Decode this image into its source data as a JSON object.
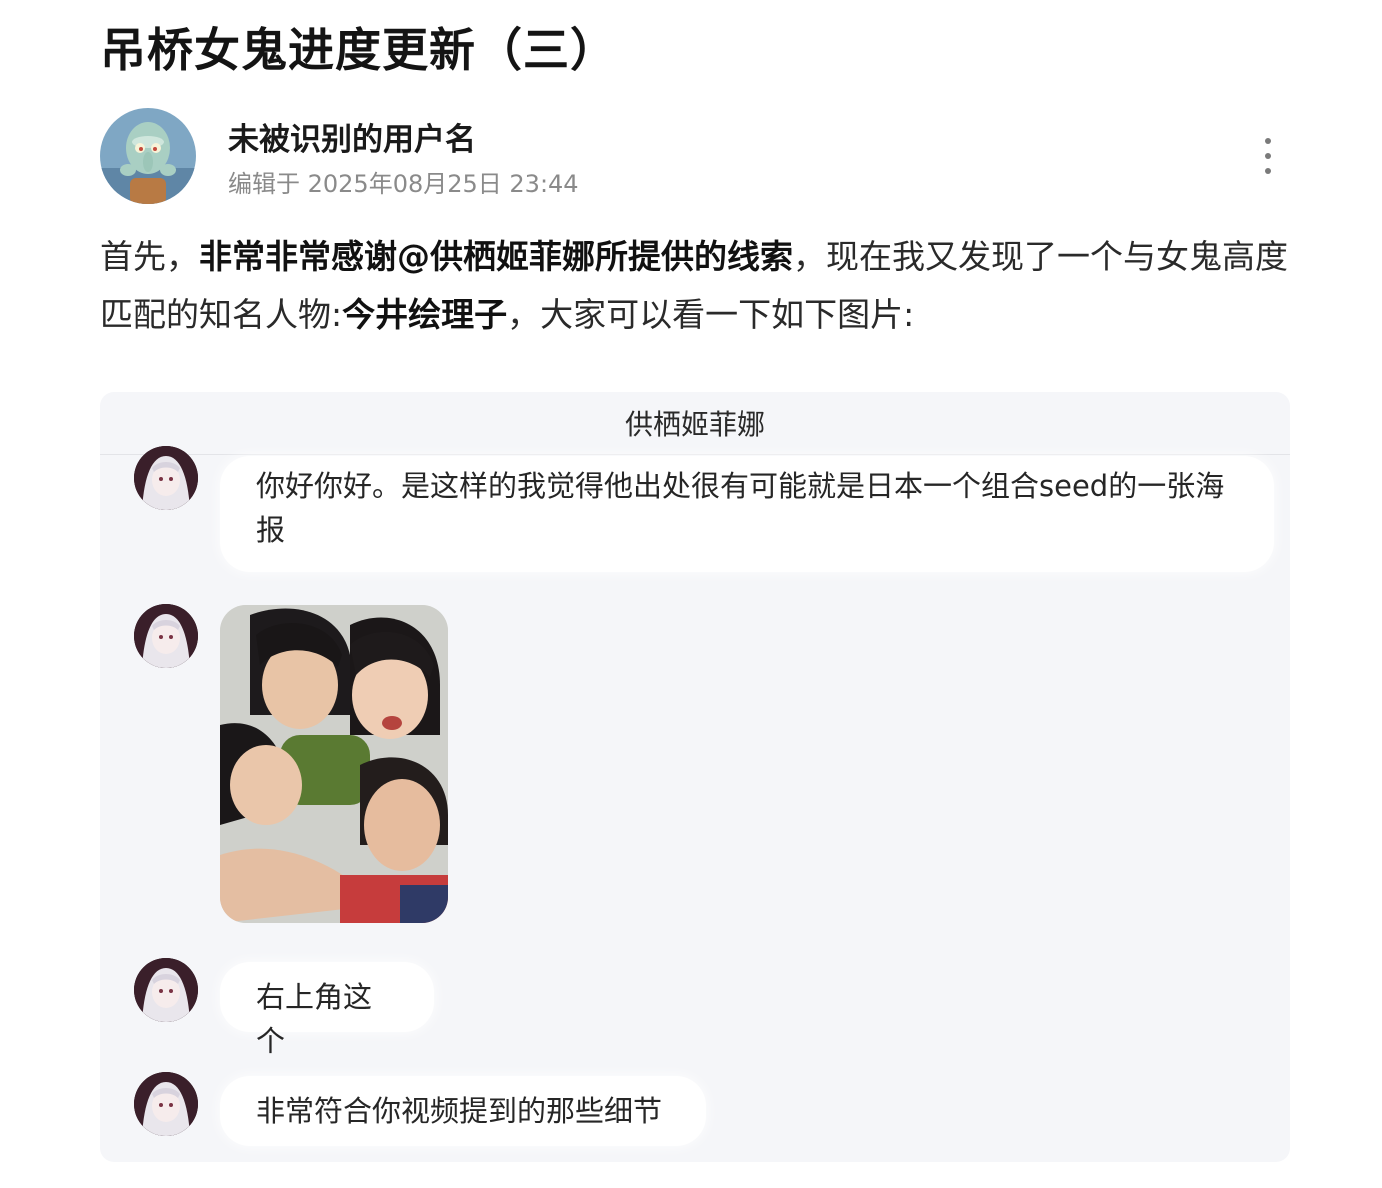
{
  "post": {
    "title": "吊桥女鬼进度更新（三）",
    "author_name": "未被识别的用户名",
    "edit_time": "编辑于 2025年08月25日 23:44",
    "body": {
      "p1": "首先，",
      "p2_bold": "非常非常感谢@供栖姬菲娜所提供的线索",
      "p3": "，现在我又发现了一个与女鬼高度匹配的知名人物:",
      "p4_bold": "今井绘理子",
      "p5": "，大家可以看一下如下图片:"
    }
  },
  "chat": {
    "contact_name": "供栖姬菲娜",
    "messages": [
      {
        "type": "text",
        "text": "你好你好。是这样的我觉得他出处很有可能就是日本一个组合seed的一张海报"
      },
      {
        "type": "image"
      },
      {
        "type": "text",
        "text": "右上角这个"
      },
      {
        "type": "text",
        "text": "非常符合你视频提到的那些细节"
      }
    ]
  },
  "icons": {
    "more": "more-vertical-icon"
  },
  "colors": {
    "chat_background": "#f5f6f9",
    "bubble": "#ffffff",
    "meta_text": "#8a8a8a"
  }
}
